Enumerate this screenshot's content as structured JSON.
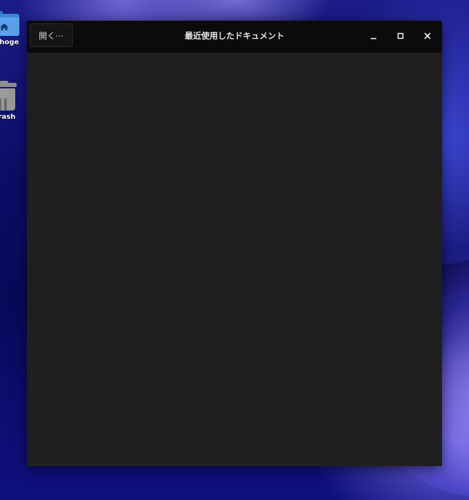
{
  "desktop": {
    "icons": [
      {
        "label": "ehoge",
        "icon": "home-folder-icon"
      },
      {
        "label": "rash",
        "icon": "trash-icon"
      }
    ]
  },
  "window": {
    "title": "最近使用したドキュメント",
    "open_button_label": "開く⋯",
    "controls": {
      "minimize": "minimize-icon",
      "maximize": "maximize-icon",
      "close": "close-icon"
    }
  },
  "colors": {
    "headerbar": "#0b0b0b",
    "window_bg": "#1f1f1f",
    "desktop_bg": "#0a0b5e",
    "folder": "#5aa3ea"
  }
}
